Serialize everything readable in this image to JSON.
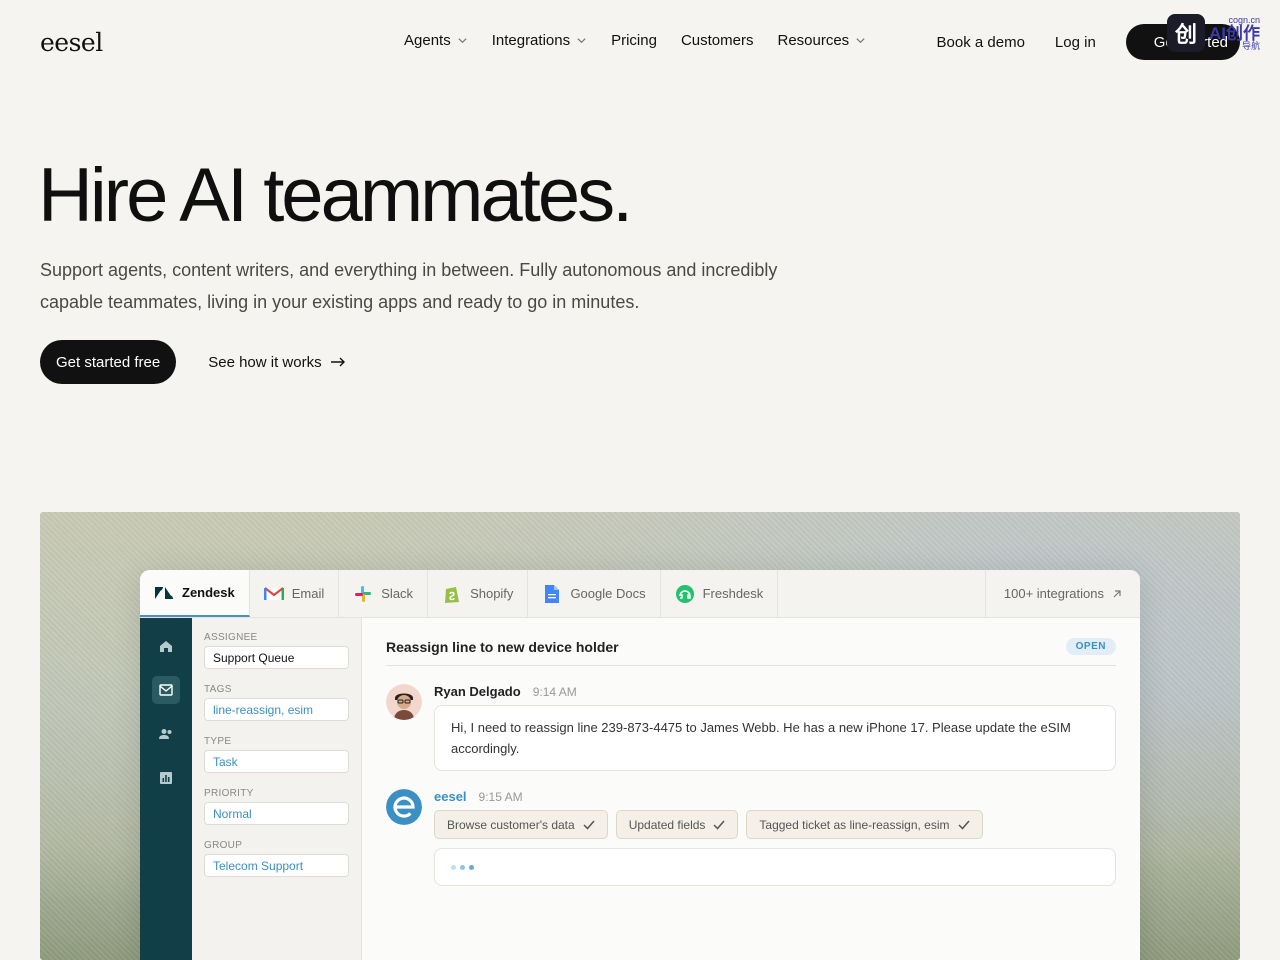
{
  "nav": {
    "logo": "eesel",
    "links": [
      {
        "label": "Agents",
        "dropdown": true
      },
      {
        "label": "Integrations",
        "dropdown": true
      },
      {
        "label": "Pricing",
        "dropdown": false
      },
      {
        "label": "Customers",
        "dropdown": false
      },
      {
        "label": "Resources",
        "dropdown": true
      }
    ],
    "book_demo": "Book a demo",
    "login": "Log in",
    "cta": "Get started",
    "overlay_badge": {
      "text": "AI创作",
      "sub1": "cogn.cn",
      "sub2": "导航"
    }
  },
  "hero": {
    "title": "Hire AI teammates.",
    "subtitle": "Support agents, content writers, and everything in between. Fully autonomous and incredibly capable teammates, living in your existing apps and ready to go in minutes.",
    "primary_cta": "Get started free",
    "secondary_cta": "See how it works"
  },
  "app": {
    "tabs": [
      {
        "label": "Zendesk",
        "icon": "zendesk-icon",
        "active": true
      },
      {
        "label": "Email",
        "icon": "gmail-icon",
        "active": false
      },
      {
        "label": "Slack",
        "icon": "slack-icon",
        "active": false
      },
      {
        "label": "Shopify",
        "icon": "shopify-icon",
        "active": false
      },
      {
        "label": "Google Docs",
        "icon": "google-docs-icon",
        "active": false
      },
      {
        "label": "Freshdesk",
        "icon": "freshdesk-icon",
        "active": false
      }
    ],
    "integrations_link": "100+ integrations",
    "rail_icons": [
      "home-icon",
      "mail-icon",
      "users-icon",
      "chart-icon"
    ],
    "properties": [
      {
        "label": "ASSIGNEE",
        "value": "Support Queue",
        "style": "plain"
      },
      {
        "label": "TAGS",
        "value": "line-reassign, esim",
        "style": "link"
      },
      {
        "label": "TYPE",
        "value": "Task",
        "style": "link"
      },
      {
        "label": "PRIORITY",
        "value": "Normal",
        "style": "link"
      },
      {
        "label": "GROUP",
        "value": "Telecom Support",
        "style": "link"
      }
    ],
    "ticket": {
      "title": "Reassign line to new device holder",
      "status": "OPEN",
      "customer": {
        "name": "Ryan Delgado",
        "time": "9:14 AM",
        "message": "Hi, I need to reassign line 239-873-4475 to James Webb. He has a new iPhone 17. Please update the eSIM accordingly."
      },
      "agent": {
        "name": "eesel",
        "time": "9:15 AM",
        "actions": [
          "Browse customer's data",
          "Updated fields",
          "Tagged ticket as line-reassign, esim"
        ]
      }
    }
  },
  "colors": {
    "accent": "#3a8fc4",
    "rail": "#123f47",
    "bg": "#f5f4f0"
  }
}
